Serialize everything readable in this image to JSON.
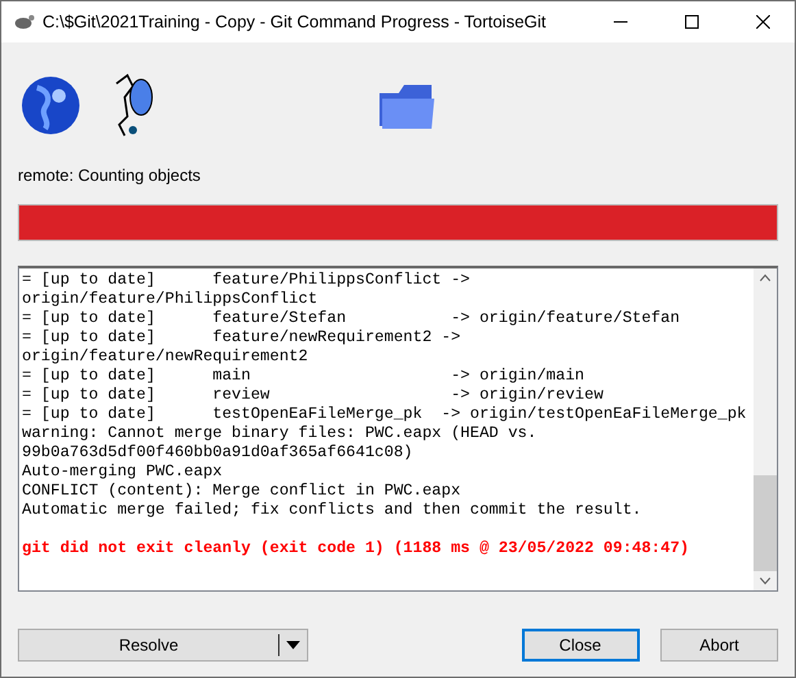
{
  "window": {
    "title": "C:\\$Git\\2021Training - Copy - Git Command Progress - TortoiseGit"
  },
  "status_text": "remote: Counting objects",
  "progress": {
    "level": 1
  },
  "log": [
    {
      "kind": "normal",
      "text": "= [up to date]      feature/PhilippsConflict ->"
    },
    {
      "kind": "normal",
      "text": "origin/feature/PhilippsConflict"
    },
    {
      "kind": "normal",
      "text": "= [up to date]      feature/Stefan           -> origin/feature/Stefan"
    },
    {
      "kind": "normal",
      "text": "= [up to date]      feature/newRequirement2 ->"
    },
    {
      "kind": "normal",
      "text": "origin/feature/newRequirement2"
    },
    {
      "kind": "normal",
      "text": "= [up to date]      main                     -> origin/main"
    },
    {
      "kind": "normal",
      "text": "= [up to date]      review                   -> origin/review"
    },
    {
      "kind": "normal",
      "text": "= [up to date]      testOpenEaFileMerge_pk  -> origin/testOpenEaFileMerge_pk"
    },
    {
      "kind": "normal",
      "text": "warning: Cannot merge binary files: PWC.eapx (HEAD vs."
    },
    {
      "kind": "normal",
      "text": "99b0a763d5df00f460bb0a91d0af365af6641c08)"
    },
    {
      "kind": "normal",
      "text": "Auto-merging PWC.eapx"
    },
    {
      "kind": "normal",
      "text": "CONFLICT (content): Merge conflict in PWC.eapx"
    },
    {
      "kind": "normal",
      "text": "Automatic merge failed; fix conflicts and then commit the result."
    },
    {
      "kind": "blank"
    },
    {
      "kind": "error",
      "text": "git did not exit cleanly (exit code 1) (1188 ms @ 23/05/2022 09:48:47)"
    }
  ],
  "buttons": [
    {
      "label": "Resolve",
      "kind": "split",
      "focused": false
    },
    {
      "label": "Close",
      "kind": "plain",
      "focused": true
    },
    {
      "label": "Abort",
      "kind": "plain",
      "focused": false
    }
  ]
}
